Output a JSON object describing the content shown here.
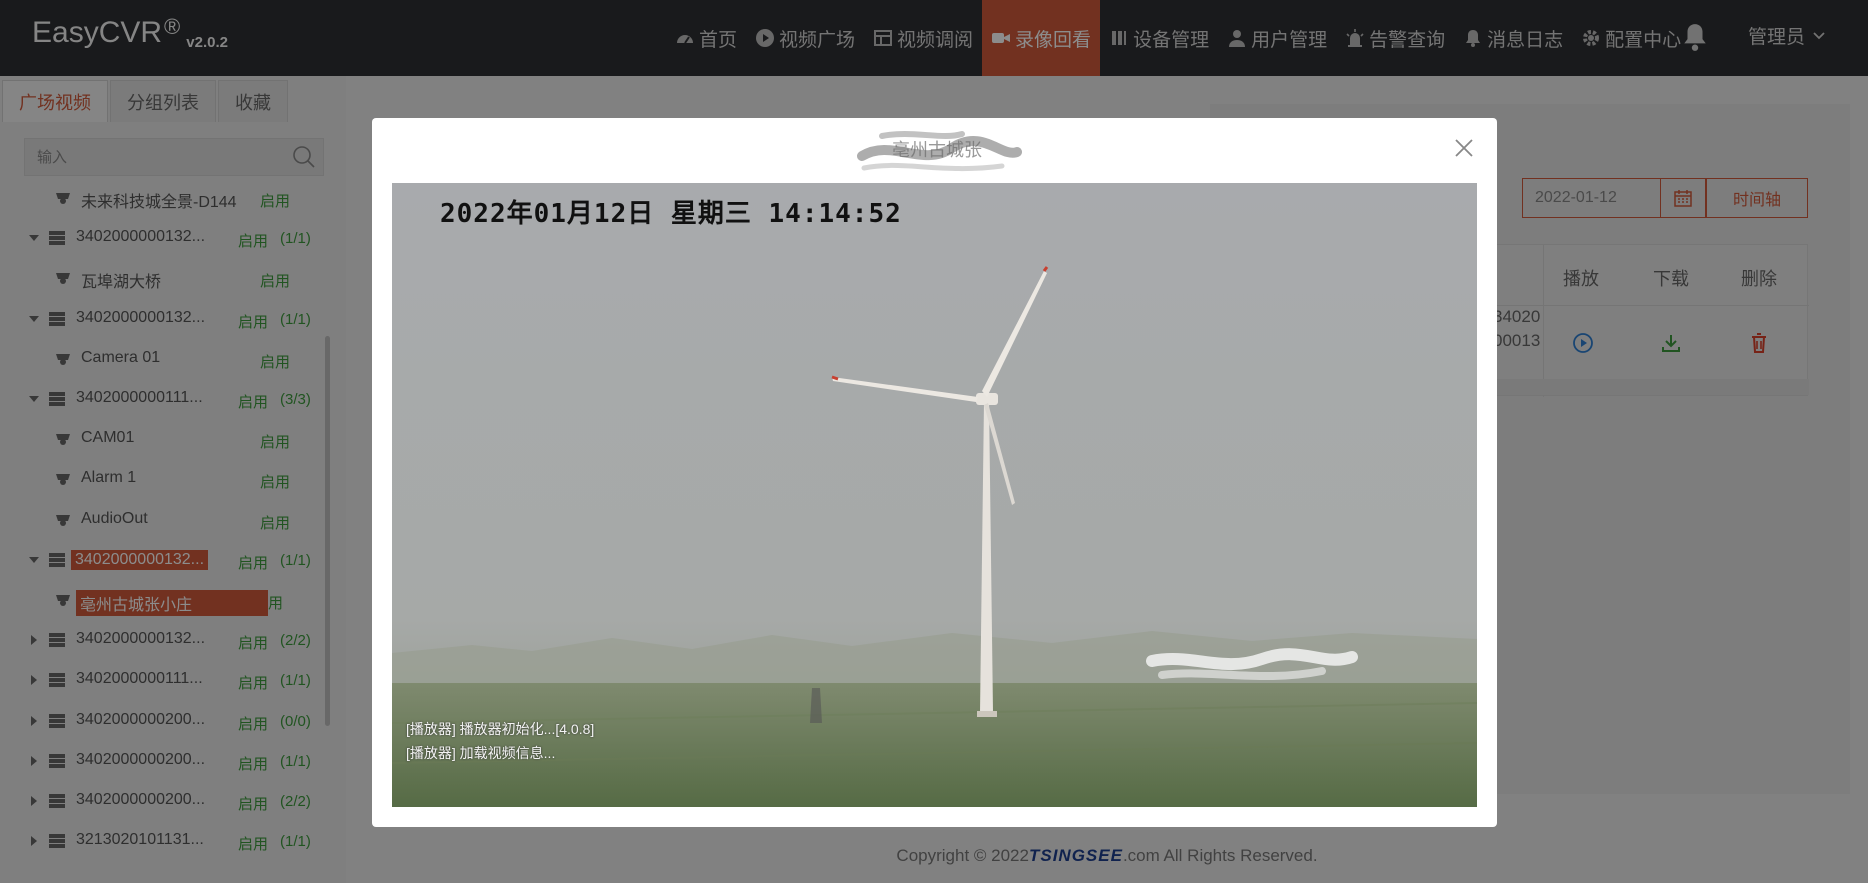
{
  "app": {
    "brand": "EasyCVR",
    "reg": "®",
    "version": "v2.0.2"
  },
  "nav": [
    {
      "label": "首页",
      "icon": "dashboard-icon",
      "active": false
    },
    {
      "label": "视频广场",
      "icon": "play-circle-icon",
      "active": false
    },
    {
      "label": "视频调阅",
      "icon": "grid-layout-icon",
      "active": false
    },
    {
      "label": "录像回看",
      "icon": "video-camera-icon",
      "active": true
    },
    {
      "label": "设备管理",
      "icon": "device-icon",
      "active": false
    },
    {
      "label": "用户管理",
      "icon": "user-icon",
      "active": false
    },
    {
      "label": "告警查询",
      "icon": "alarm-light-icon",
      "active": false
    },
    {
      "label": "消息日志",
      "icon": "bell-small-icon",
      "active": false
    },
    {
      "label": "配置中心",
      "icon": "gear-icon",
      "active": false
    }
  ],
  "user": {
    "name": "管理员"
  },
  "sidebar": {
    "tabs": [
      "广场视频",
      "分组列表",
      "收藏"
    ],
    "search_placeholder": "输入",
    "tree": [
      {
        "level": 1,
        "name": "未来科技城全景-D144",
        "status": "启用",
        "count": ""
      },
      {
        "level": 0,
        "name": "3402000000132...",
        "status": "启用",
        "count": "(1/1)",
        "expanded": true
      },
      {
        "level": 1,
        "name": "瓦埠湖大桥",
        "status": "启用",
        "count": ""
      },
      {
        "level": 0,
        "name": "3402000000132...",
        "status": "启用",
        "count": "(1/1)",
        "expanded": true
      },
      {
        "level": 1,
        "name": "Camera 01",
        "status": "启用",
        "count": ""
      },
      {
        "level": 0,
        "name": "3402000000111...",
        "status": "启用",
        "count": "(3/3)",
        "expanded": true
      },
      {
        "level": 1,
        "name": "CAM01",
        "status": "启用",
        "count": ""
      },
      {
        "level": 1,
        "name": "Alarm 1",
        "status": "启用",
        "count": ""
      },
      {
        "level": 1,
        "name": "AudioOut",
        "status": "启用",
        "count": ""
      },
      {
        "level": 0,
        "name": "3402000000132...",
        "status": "启用",
        "count": "(1/1)",
        "expanded": true,
        "highlight": true
      },
      {
        "level": 1,
        "name": "亳州古城张小庄",
        "status": "启用",
        "count": "",
        "highlight": true
      },
      {
        "level": 0,
        "name": "3402000000132...",
        "status": "启用",
        "count": "(2/2)",
        "expanded": false
      },
      {
        "level": 0,
        "name": "3402000000111...",
        "status": "启用",
        "count": "(1/1)",
        "expanded": false
      },
      {
        "level": 0,
        "name": "3402000000200...",
        "status": "启用",
        "count": "(0/0)",
        "expanded": false
      },
      {
        "level": 0,
        "name": "3402000000200...",
        "status": "启用",
        "count": "(1/1)",
        "expanded": false
      },
      {
        "level": 0,
        "name": "3402000000200...",
        "status": "启用",
        "count": "(2/2)",
        "expanded": false
      },
      {
        "level": 0,
        "name": "3213020101131...",
        "status": "启用",
        "count": "(1/1)",
        "expanded": false
      }
    ]
  },
  "main": {
    "date": "2022-01-12",
    "timeline_label": "时间轴",
    "table": {
      "headers": [
        "播放",
        "下载",
        "删除"
      ],
      "row_id_lines": [
        "34020",
        "00013"
      ]
    }
  },
  "footer": {
    "prefix": "Copyright © 2022 ",
    "logo": "TSINGSEE",
    "suffix": ".com All Rights Reserved."
  },
  "modal": {
    "title": "亳州古城张",
    "osd_time": "2022年01月12日 星期三 14:14:52",
    "logs": [
      "[播放器] 播放器初始化...[4.0.8]",
      "[播放器] 加载视频信息..."
    ]
  },
  "colors": {
    "accent": "#cf5a3b",
    "topbar": "#2f3033",
    "status_green": "#3c9a3c",
    "play_blue": "#2f7fd1",
    "download_green": "#3c9a3c",
    "delete_red": "#d9412a"
  }
}
